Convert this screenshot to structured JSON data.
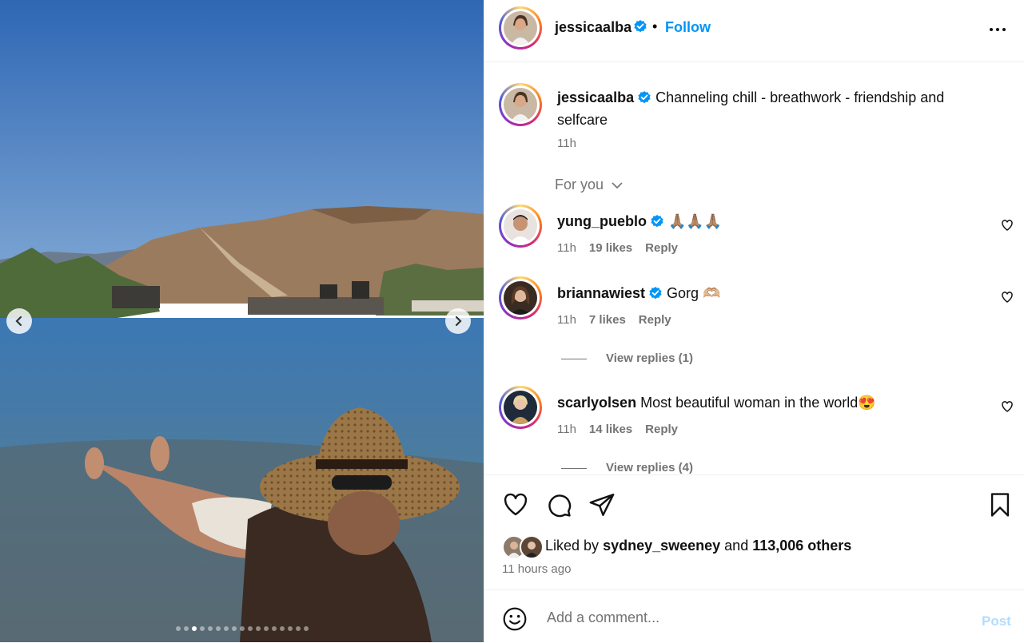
{
  "post": {
    "author": "jessicaalba",
    "follow_label": "Follow",
    "separator": "•",
    "caption": "Channeling chill - breathwork - friendship and selfcare",
    "caption_time": "11h",
    "media": {
      "slide_count": 17,
      "active_slide": 3
    }
  },
  "comments_section": {
    "sort_label": "For you",
    "items": [
      {
        "username": "yung_pueblo",
        "verified": true,
        "text": "🙏🏽🙏🏽🙏🏽",
        "time": "11h",
        "likes": "19 likes",
        "reply": "Reply"
      },
      {
        "username": "briannawiest",
        "verified": true,
        "text": "Gorg 🫶🏼",
        "time": "11h",
        "likes": "7 likes",
        "reply": "Reply",
        "view_replies": "View replies (1)"
      },
      {
        "username": "scarlyolsen",
        "verified": false,
        "text": "Most beautiful woman in the world😍",
        "time": "11h",
        "likes": "14 likes",
        "reply": "Reply",
        "view_replies": "View replies (4)"
      }
    ]
  },
  "engagement": {
    "liked_by_prefix": "Liked by",
    "liked_by_user": "sydney_sweeney",
    "liked_by_and": "and",
    "liked_by_others": "113,006 others",
    "time_ago": "11 hours ago"
  },
  "composer": {
    "placeholder": "Add a comment...",
    "post_label": "Post"
  },
  "icons": [
    "more-options-icon",
    "verified-badge-icon",
    "heart-icon",
    "comment-icon",
    "share-icon",
    "bookmark-icon",
    "emoji-icon",
    "chevron-left-icon",
    "chevron-right-icon",
    "chevron-down-icon"
  ],
  "colors": {
    "accent": "#0095f6",
    "verified": "#0095f6",
    "muted": "#737373",
    "post_disabled": "#b3dbff"
  }
}
